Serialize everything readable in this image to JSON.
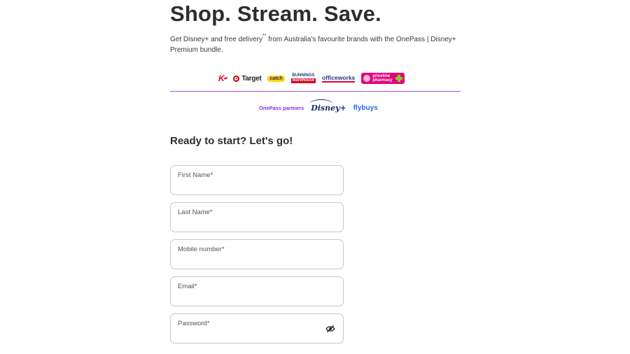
{
  "hero": {
    "headline": "Shop. Stream. Save.",
    "subtext_a": "Get Disney+ and free delivery",
    "subtext_sup": "**",
    "subtext_b": " from Australia’s favourite brands with the OnePass | Disney+ Premium bundle."
  },
  "brands": {
    "kmart": "K",
    "target": "Target",
    "catch": "catch",
    "bunnings_top": "BUNNINGS",
    "bunnings_bottom": "warehouse",
    "officeworks": "officeworks",
    "priceline": "priceline pharmacy"
  },
  "partners": {
    "label": "OnePass partners",
    "disney": "Disney+",
    "flybuys": "flybuys"
  },
  "form": {
    "title": "Ready to start? Let's go!",
    "first_name_label": "First Name*",
    "last_name_label": "Last Name*",
    "mobile_label": "Mobile number*",
    "email_label": "Email*",
    "password_label": "Password*"
  },
  "colors": {
    "divider": "#a855d6",
    "partners_label": "#8a2be2"
  },
  "icons": {
    "password_toggle": "eye-off-icon"
  }
}
